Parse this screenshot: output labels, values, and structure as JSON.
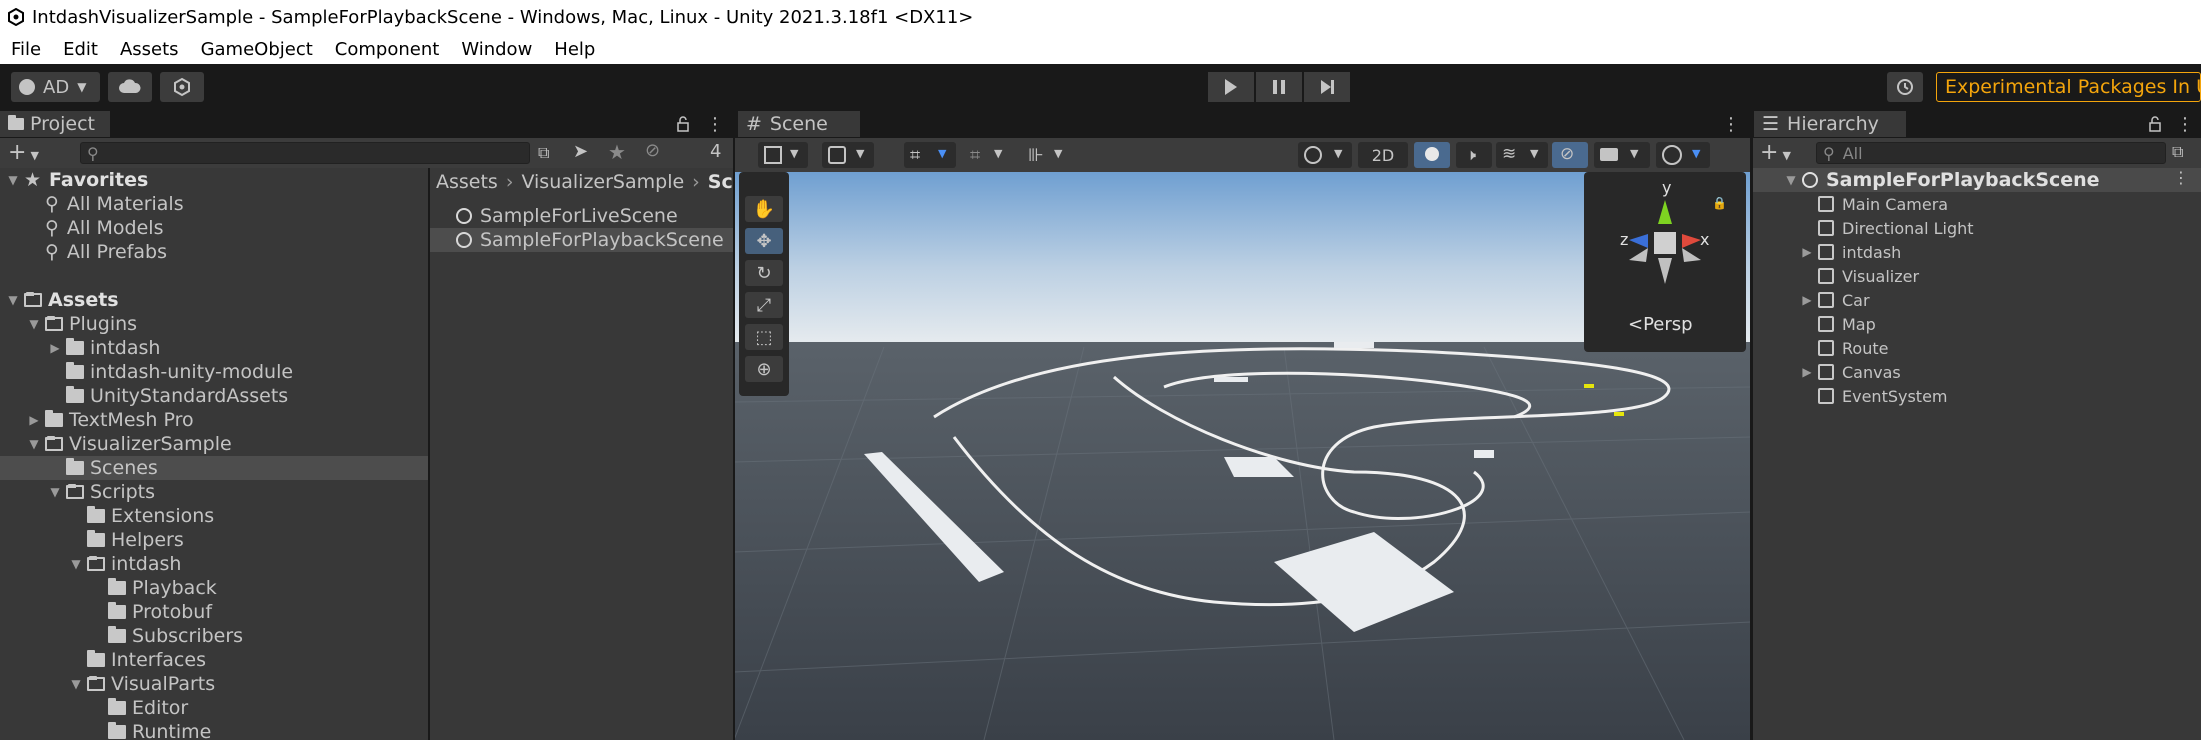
{
  "window": {
    "title": "IntdashVisualizerSample - SampleForPlaybackScene - Windows, Mac, Linux - Unity 2021.3.18f1 <DX11>"
  },
  "menu": [
    "File",
    "Edit",
    "Assets",
    "GameObject",
    "Component",
    "Window",
    "Help"
  ],
  "toolbar": {
    "account": "AD",
    "experimental": "Experimental Packages In Use"
  },
  "project": {
    "tab": "Project",
    "hidden_count": "4",
    "tree": [
      {
        "label": "Favorites",
        "bold": true,
        "depth": 0,
        "arrow": "down",
        "icon": "star"
      },
      {
        "label": "All Materials",
        "depth": 1,
        "icon": "search"
      },
      {
        "label": "All Models",
        "depth": 1,
        "icon": "search"
      },
      {
        "label": "All Prefabs",
        "depth": 1,
        "icon": "search"
      },
      {
        "label": "",
        "depth": 0,
        "icon": "none"
      },
      {
        "label": "Assets",
        "bold": true,
        "depth": 0,
        "arrow": "down",
        "icon": "folder-open"
      },
      {
        "label": "Plugins",
        "depth": 1,
        "arrow": "down",
        "icon": "folder-open"
      },
      {
        "label": "intdash",
        "depth": 2,
        "arrow": "right",
        "icon": "folder"
      },
      {
        "label": "intdash-unity-module",
        "depth": 2,
        "icon": "folder"
      },
      {
        "label": "UnityStandardAssets",
        "depth": 2,
        "icon": "folder"
      },
      {
        "label": "TextMesh Pro",
        "depth": 1,
        "arrow": "right",
        "icon": "folder"
      },
      {
        "label": "VisualizerSample",
        "depth": 1,
        "arrow": "down",
        "icon": "folder-open"
      },
      {
        "label": "Scenes",
        "depth": 2,
        "icon": "folder",
        "selected": true
      },
      {
        "label": "Scripts",
        "depth": 2,
        "arrow": "down",
        "icon": "folder-open"
      },
      {
        "label": "Extensions",
        "depth": 3,
        "icon": "folder"
      },
      {
        "label": "Helpers",
        "depth": 3,
        "icon": "folder"
      },
      {
        "label": "intdash",
        "depth": 3,
        "arrow": "down",
        "icon": "folder-open"
      },
      {
        "label": "Playback",
        "depth": 4,
        "icon": "folder"
      },
      {
        "label": "Protobuf",
        "depth": 4,
        "icon": "folder"
      },
      {
        "label": "Subscribers",
        "depth": 4,
        "icon": "folder"
      },
      {
        "label": "Interfaces",
        "depth": 3,
        "icon": "folder"
      },
      {
        "label": "VisualParts",
        "depth": 3,
        "arrow": "down",
        "icon": "folder-open"
      },
      {
        "label": "Editor",
        "depth": 4,
        "icon": "folder"
      },
      {
        "label": "Runtime",
        "depth": 4,
        "icon": "folder"
      }
    ],
    "breadcrumb": [
      "Assets",
      "VisualizerSample",
      "Sce"
    ],
    "files": [
      {
        "label": "SampleForLiveScene",
        "selected": false
      },
      {
        "label": "SampleForPlaybackScene",
        "selected": true
      }
    ]
  },
  "scene": {
    "tab": "Scene",
    "toggle_2d": "2D",
    "gizmo": {
      "y": "y",
      "x": "x",
      "z": "z",
      "persp": "Persp"
    }
  },
  "hierarchy": {
    "tab": "Hierarchy",
    "search_placeholder": "All",
    "root": "SampleForPlaybackScene",
    "items": [
      {
        "label": "Main Camera",
        "arrow": false
      },
      {
        "label": "Directional Light",
        "arrow": false
      },
      {
        "label": "intdash",
        "arrow": true
      },
      {
        "label": "Visualizer",
        "arrow": false
      },
      {
        "label": "Car",
        "arrow": true
      },
      {
        "label": "Map",
        "arrow": false
      },
      {
        "label": "Route",
        "arrow": false
      },
      {
        "label": "Canvas",
        "arrow": true
      },
      {
        "label": "EventSystem",
        "arrow": false
      }
    ]
  }
}
